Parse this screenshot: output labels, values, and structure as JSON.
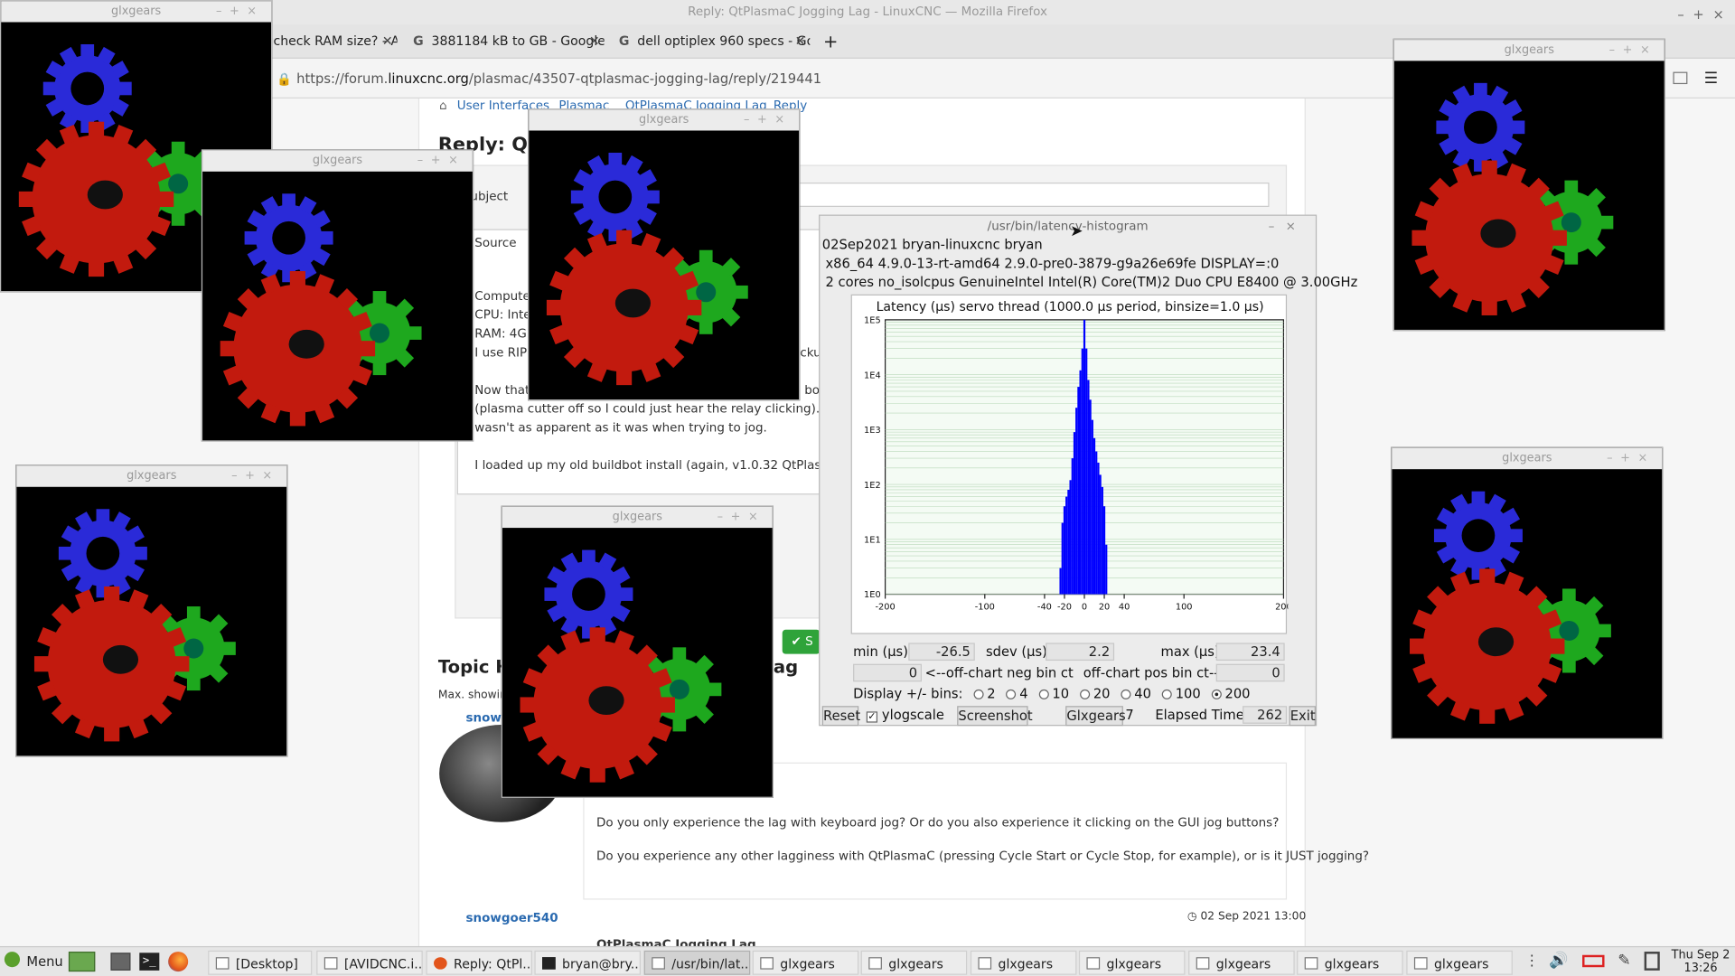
{
  "firefox": {
    "title": "Reply: QtPlasmaC Jogging Lag - LinuxCNC — Mozilla Firefox",
    "tabs": [
      {
        "label": "check RAM size? - As"
      },
      {
        "label": "3881184 kB to GB - Google"
      },
      {
        "label": "dell optiplex 960 specs - Go"
      }
    ],
    "new_tab": "+",
    "url_prefix": "https://forum.",
    "url_domain": "linuxcnc.org",
    "url_path": "/plasmac/43507-qtplasmac-jogging-lag/reply/219441"
  },
  "page": {
    "breadcrumb": [
      "User Interfaces",
      "Plasmac",
      "QtPlasmaC Jogging Lag",
      "Reply"
    ],
    "heading": "Reply: Qt",
    "subject_label": "ubject",
    "source_label": "Source",
    "editor_lines": [
      "Compute",
      "CPU: Inte",
      "RAM: 4GE",
      "I use RIP",
      "Now that",
      "(plasma cutter off so I could just hear the relay clicking). C",
      "wasn't as apparent as it was when trying to jog.",
      "I loaded up my old buildbot install (again, v1.0.32 QtPlasm"
    ],
    "editor_right": [
      "ckup",
      "bo"
    ],
    "submit_label": "S",
    "topic_heading": "Topic H",
    "topic_tail": "ag",
    "max_showing": "Max. showin",
    "user1": "snowg",
    "q1": "Do you only experience the lag with keyboard jog? Or do you also experience it clicking on the GUI jog buttons?",
    "q2": "Do you experience any other lagginess with QtPlasmaC (pressing Cycle Start or Cycle Stop, for example), or is it JUST jogging?",
    "user2": "snowgoer540",
    "date2": "02 Sep 2021 13:00",
    "post2_title": "QtPlasmaC Jogging Lag"
  },
  "glxgears_title": "glxgears",
  "latency": {
    "title": "/usr/bin/latency-histogram",
    "line1": "02Sep2021 bryan-linuxcnc bryan",
    "line2": "x86_64  4.9.0-13-rt-amd64  2.9.0-pre0-3879-g9a26e69fe  DISPLAY=:0",
    "line3": "2 cores  no_isolcpus   GenuineIntel   Intel(R) Core(TM)2 Duo CPU E8400 @ 3.00GHz",
    "min_label": "min (µs)",
    "min_val": "-26.5",
    "sdev_label": "sdev (µs)",
    "sdev_val": "2.2",
    "max_label": "max (µs)",
    "max_val": "23.4",
    "neg_val": "0",
    "neg_label": "<--off-chart neg bin ct",
    "pos_label": "off-chart pos bin ct-->",
    "pos_val": "0",
    "bins_label": "Display +/- bins:",
    "bins": [
      "2",
      "4",
      "10",
      "20",
      "40",
      "100",
      "200"
    ],
    "selected_bin": "200",
    "reset": "Reset",
    "ylogscale": "ylogscale",
    "screenshot": "Screenshot",
    "glxgears": "Glxgears",
    "glx_count": "7",
    "elapsed_label": "Elapsed Time:",
    "elapsed_val": "262",
    "exit": "Exit"
  },
  "chart_data": {
    "type": "bar",
    "title": "Latency (µs) servo thread (1000.0 µs period, binsize=1.0 µs)",
    "xlabel": "",
    "ylabel": "",
    "x_ticks": [
      "-200",
      "-100",
      "-40",
      "-20",
      "0",
      "20",
      "40",
      "100",
      "200"
    ],
    "y_ticks": [
      "1E0",
      "1E1",
      "1E2",
      "1E3",
      "1E4",
      "1E5"
    ],
    "y_scale": "log",
    "xlim": [
      -200,
      200
    ],
    "ylim": [
      1,
      100000
    ],
    "grid": true,
    "bar_color": "#0000ff",
    "x": [
      -26,
      -24,
      -22,
      -20,
      -18,
      -16,
      -14,
      -12,
      -10,
      -8,
      -6,
      -4,
      -2,
      0,
      2,
      4,
      6,
      8,
      10,
      12,
      14,
      16,
      18,
      20,
      22,
      24
    ],
    "values": [
      1,
      3,
      20,
      40,
      60,
      80,
      120,
      300,
      900,
      2500,
      6000,
      12000,
      30000,
      100000,
      30000,
      8000,
      3500,
      1500,
      700,
      400,
      250,
      150,
      90,
      40,
      8,
      1
    ]
  },
  "taskbar": {
    "menu": "Menu",
    "items": [
      {
        "label": "[Desktop]"
      },
      {
        "label": "[AVIDCNC.i..."
      },
      {
        "label": "Reply: QtPl..."
      },
      {
        "label": "bryan@bry..."
      },
      {
        "label": "/usr/bin/lat..."
      },
      {
        "label": "glxgears"
      },
      {
        "label": "glxgears"
      },
      {
        "label": "glxgears"
      },
      {
        "label": "glxgears"
      },
      {
        "label": "glxgears"
      },
      {
        "label": "glxgears"
      },
      {
        "label": "glxgears"
      }
    ],
    "clock_day": "Thu Sep 2",
    "clock_time": "13:26"
  }
}
